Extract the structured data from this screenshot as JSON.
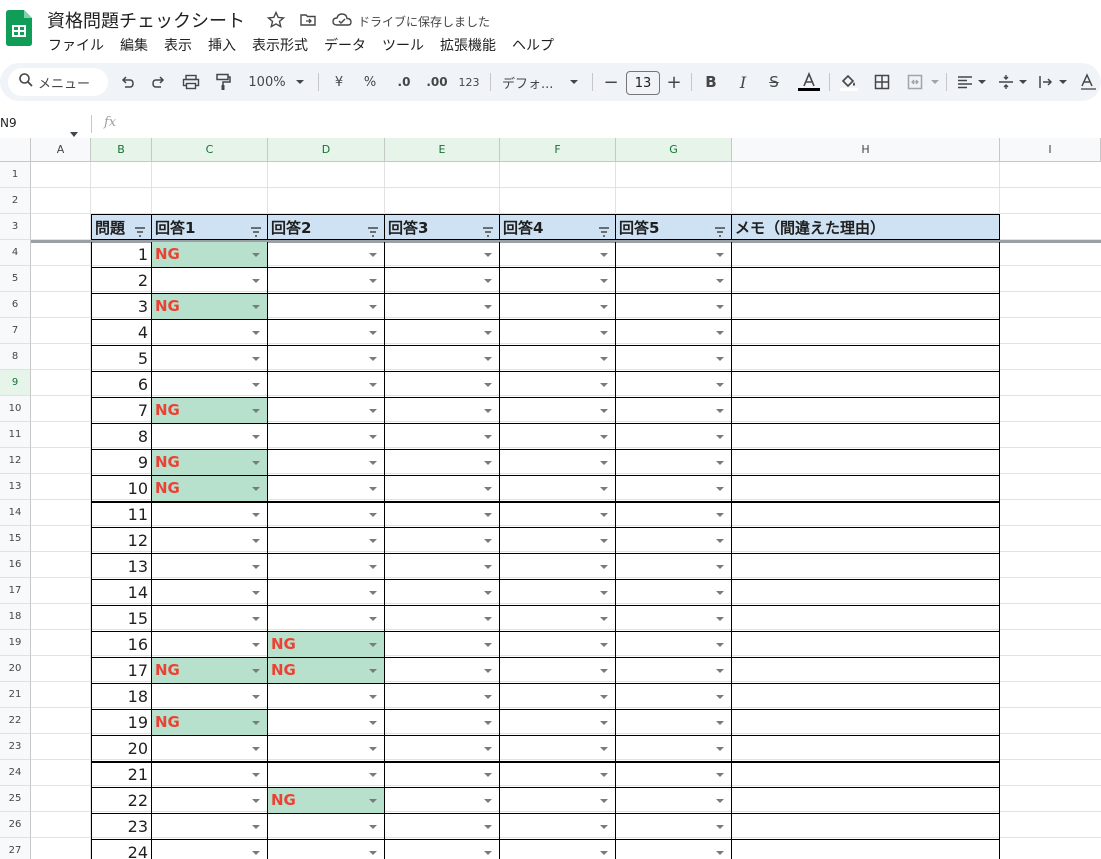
{
  "app": {
    "title": "資格問題チェックシート",
    "save_status": "ドライブに保存しました",
    "menus": [
      "ファイル",
      "編集",
      "表示",
      "挿入",
      "表示形式",
      "データ",
      "ツール",
      "拡張機能",
      "ヘルプ"
    ]
  },
  "toolbar": {
    "search_label": "メニュー",
    "zoom": "100%",
    "currency": "¥",
    "percent": "%",
    "decimal_decrease": ".0",
    "decimal_increase": ".00",
    "number_format": "123",
    "font": "デフォ...",
    "font_size": "13"
  },
  "formula_bar": {
    "name_box": "N9",
    "fx": "fx"
  },
  "columns": [
    "A",
    "B",
    "C",
    "D",
    "E",
    "F",
    "G",
    "H",
    "I"
  ],
  "row_numbers": [
    "1",
    "2",
    "3",
    "4",
    "5",
    "6",
    "7",
    "8",
    "9",
    "10",
    "11",
    "12",
    "13",
    "14",
    "15",
    "16",
    "17",
    "18",
    "19",
    "20",
    "21",
    "22",
    "23",
    "24",
    "25",
    "26",
    "27"
  ],
  "selected_row": "9",
  "sheet": {
    "headers": [
      "問題",
      "回答1",
      "回答2",
      "回答3",
      "回答4",
      "回答5",
      "メモ（間違えた理由）"
    ],
    "rows": [
      {
        "q": "1",
        "answers": [
          "NG",
          "",
          "",
          "",
          ""
        ]
      },
      {
        "q": "2",
        "answers": [
          "",
          "",
          "",
          "",
          ""
        ]
      },
      {
        "q": "3",
        "answers": [
          "NG",
          "",
          "",
          "",
          ""
        ]
      },
      {
        "q": "4",
        "answers": [
          "",
          "",
          "",
          "",
          ""
        ]
      },
      {
        "q": "5",
        "answers": [
          "",
          "",
          "",
          "",
          ""
        ]
      },
      {
        "q": "6",
        "answers": [
          "",
          "",
          "",
          "",
          ""
        ]
      },
      {
        "q": "7",
        "answers": [
          "NG",
          "",
          "",
          "",
          ""
        ]
      },
      {
        "q": "8",
        "answers": [
          "",
          "",
          "",
          "",
          ""
        ]
      },
      {
        "q": "9",
        "answers": [
          "NG",
          "",
          "",
          "",
          ""
        ]
      },
      {
        "q": "10",
        "answers": [
          "NG",
          "",
          "",
          "",
          ""
        ]
      },
      {
        "q": "11",
        "answers": [
          "",
          "",
          "",
          "",
          ""
        ]
      },
      {
        "q": "12",
        "answers": [
          "",
          "",
          "",
          "",
          ""
        ]
      },
      {
        "q": "13",
        "answers": [
          "",
          "",
          "",
          "",
          ""
        ]
      },
      {
        "q": "14",
        "answers": [
          "",
          "",
          "",
          "",
          ""
        ]
      },
      {
        "q": "15",
        "answers": [
          "",
          "",
          "",
          "",
          ""
        ]
      },
      {
        "q": "16",
        "answers": [
          "",
          "NG",
          "",
          "",
          ""
        ]
      },
      {
        "q": "17",
        "answers": [
          "NG",
          "NG",
          "",
          "",
          ""
        ]
      },
      {
        "q": "18",
        "answers": [
          "",
          "",
          "",
          "",
          ""
        ]
      },
      {
        "q": "19",
        "answers": [
          "NG",
          "",
          "",
          "",
          ""
        ]
      },
      {
        "q": "20",
        "answers": [
          "",
          "",
          "",
          "",
          ""
        ]
      },
      {
        "q": "21",
        "answers": [
          "",
          "",
          "",
          "",
          ""
        ]
      },
      {
        "q": "22",
        "answers": [
          "",
          "NG",
          "",
          "",
          ""
        ]
      },
      {
        "q": "23",
        "answers": [
          "",
          "",
          "",
          "",
          ""
        ]
      },
      {
        "q": "24",
        "answers": [
          "",
          "",
          "",
          "",
          ""
        ]
      }
    ]
  },
  "colors": {
    "header_fill": "#cfe2f3",
    "ng_fill": "#b7e1cd",
    "ng_text": "#ea4335",
    "sheets_green": "#0f9d58"
  }
}
